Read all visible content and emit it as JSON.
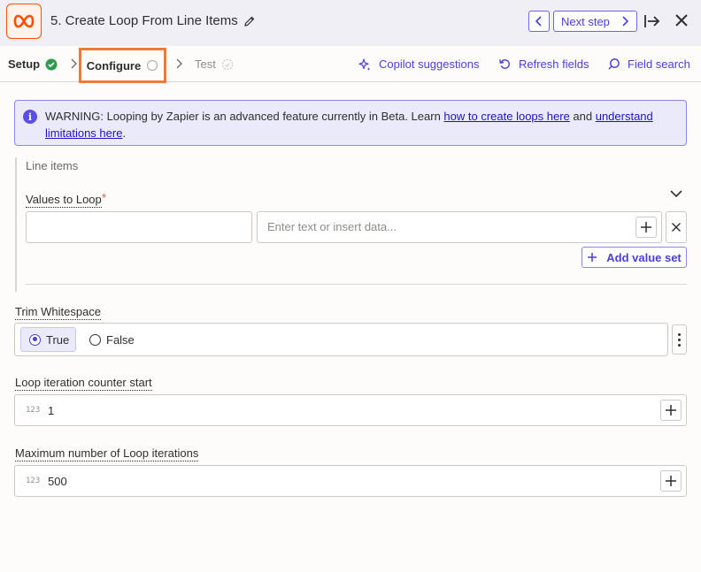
{
  "header": {
    "title": "5. Create Loop From Line Items",
    "next_step_label": "Next step"
  },
  "tabs": {
    "setup": "Setup",
    "configure": "Configure",
    "test": "Test"
  },
  "tools": {
    "copilot": "Copilot suggestions",
    "refresh": "Refresh fields",
    "search": "Field search"
  },
  "warning": {
    "text_before": "WARNING: Looping by Zapier is an advanced feature currently in Beta. Learn ",
    "link1": "how to create loops here",
    "text_middle": " and ",
    "link2": "understand limitations here",
    "text_after": "."
  },
  "line_items": {
    "group_title": "Line items",
    "values_label": "Values to Loop",
    "required_mark": "*",
    "key_value": "",
    "value_placeholder": "Enter text or insert data...",
    "add_value_label": "Add value set"
  },
  "trim_whitespace": {
    "label": "Trim Whitespace",
    "option_true": "True",
    "option_false": "False",
    "selected": "True"
  },
  "counter_start": {
    "label": "Loop iteration counter start",
    "type_tag": "123",
    "value": "1"
  },
  "max_iterations": {
    "label": "Maximum number of Loop iterations",
    "type_tag": "123",
    "value": "500"
  },
  "colors": {
    "accent": "#4a3fd8",
    "brand": "#ff4f00",
    "success": "#2e9b4f",
    "highlight_box": "#ef7a36"
  }
}
